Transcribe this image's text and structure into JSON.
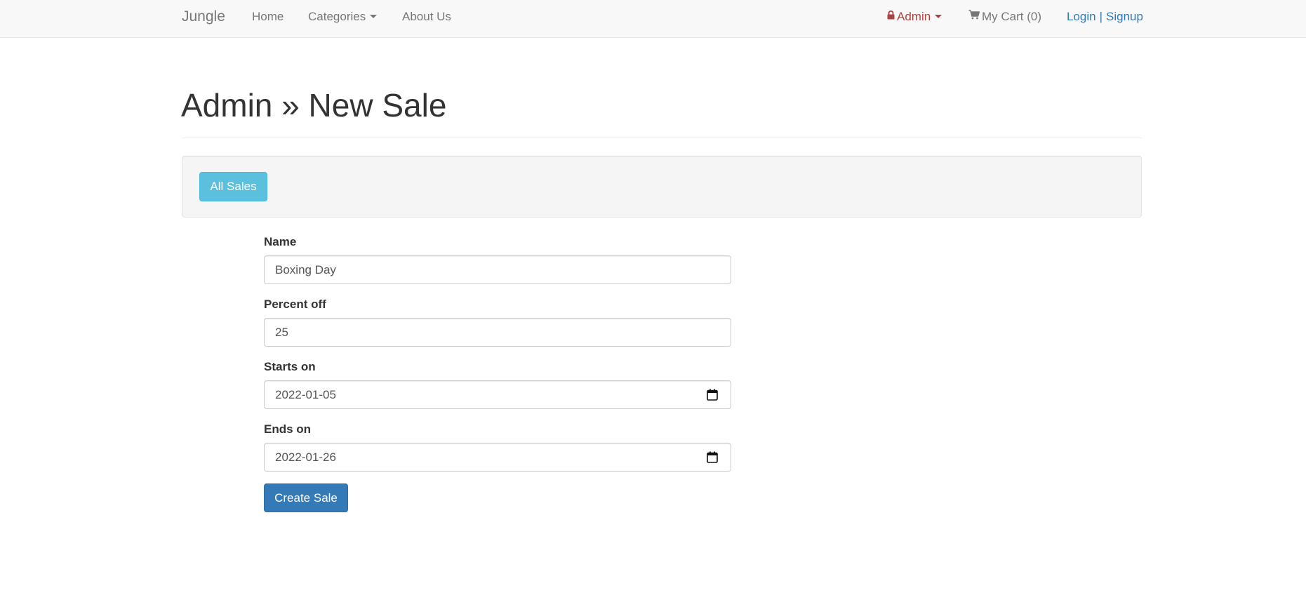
{
  "navbar": {
    "brand": "Jungle",
    "home": "Home",
    "categories": "Categories",
    "about": "About Us",
    "admin": "Admin",
    "cart": "My Cart (0)",
    "login": "Login",
    "separator": "|",
    "signup": "Signup"
  },
  "page": {
    "title": "Admin » New Sale"
  },
  "actions": {
    "all_sales": "All Sales"
  },
  "form": {
    "name_label": "Name",
    "name_value": "Boxing Day",
    "percent_label": "Percent off",
    "percent_value": "25",
    "starts_label": "Starts on",
    "starts_value": "2022-01-05",
    "ends_label": "Ends on",
    "ends_value": "2022-01-26",
    "submit": "Create Sale"
  },
  "icons": {
    "admin": "lock-icon",
    "cart": "shopping-cart-icon",
    "date": "calendar-icon"
  },
  "colors": {
    "navbar_bg": "#f8f8f8",
    "admin_text": "#a94442",
    "link": "#337ab7",
    "info_button": "#5bc0de",
    "primary_button": "#337ab7"
  }
}
